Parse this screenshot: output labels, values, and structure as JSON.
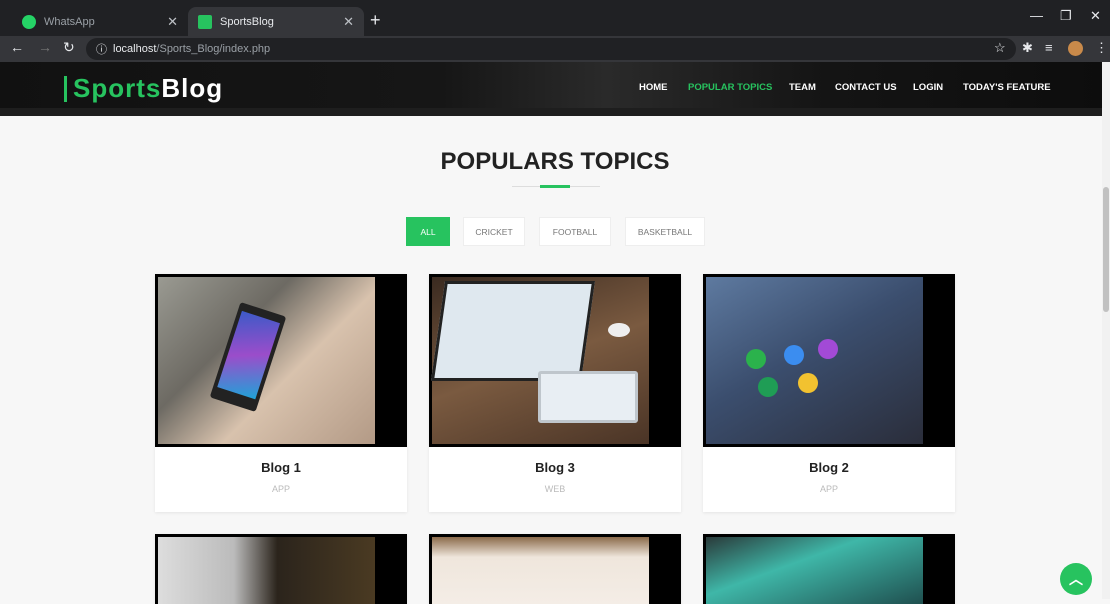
{
  "browser": {
    "tabs": [
      {
        "title": "WhatsApp",
        "icon": "whatsapp-icon",
        "active": false
      },
      {
        "title": "SportsBlog",
        "icon": "sportsblog-favicon-icon",
        "active": true
      }
    ],
    "url_host": "localhost",
    "url_path": "/Sports_Blog/index.php"
  },
  "site": {
    "logo_green": "Sports",
    "logo_white": "Blog",
    "nav": [
      "HOME",
      "POPULAR TOPICS",
      "TEAM",
      "CONTACT US",
      "LOGIN",
      "TODAY'S FEATURE"
    ],
    "active_nav": "POPULAR TOPICS"
  },
  "section": {
    "title": "POPULARS TOPICS",
    "filters": [
      "ALL",
      "CRICKET",
      "FOOTBALL",
      "BASKETBALL"
    ],
    "active_filter": "ALL"
  },
  "cards": [
    {
      "name": "Blog 1",
      "category": "APP"
    },
    {
      "name": "Blog 3",
      "category": "WEB"
    },
    {
      "name": "Blog 2",
      "category": "APP"
    }
  ],
  "colors": {
    "accent": "#27c35f",
    "header_bg": "#111111"
  }
}
